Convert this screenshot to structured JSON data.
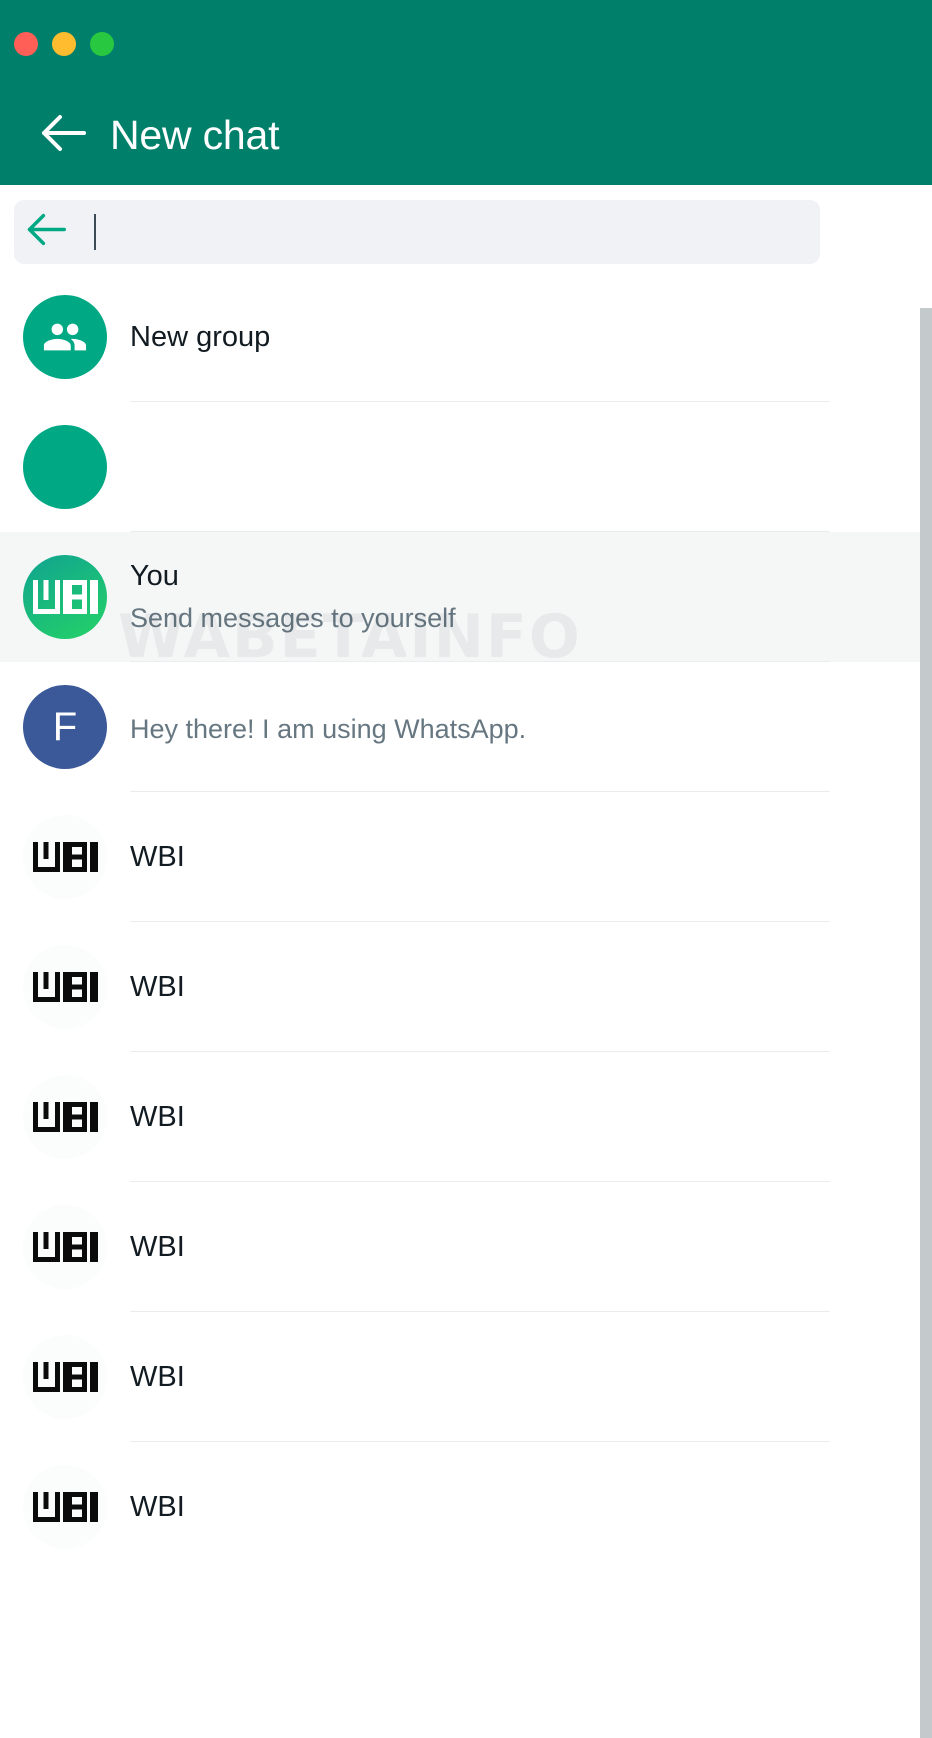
{
  "window": {
    "traffic_lights": [
      {
        "name": "close-button",
        "color": "#ff5f57"
      },
      {
        "name": "minimize-button",
        "color": "#febc2e"
      },
      {
        "name": "maximize-button",
        "color": "#28c840"
      }
    ],
    "header": {
      "back_icon": "arrow-left-icon",
      "title": "New chat",
      "background": "#00806a",
      "title_color": "#ffffff"
    }
  },
  "search": {
    "back_icon": "arrow-left-icon",
    "value": "",
    "placeholder": "",
    "background": "#f0f2f5",
    "caret_visible": true
  },
  "watermark": {
    "text": "WABETAINFO"
  },
  "scrollbar": {
    "orientation": "vertical",
    "thumb_color": "#c4c9cc"
  },
  "list": {
    "rows": [
      {
        "name": "new-group",
        "avatar_type": "green-people",
        "avatar_glyph": "people-icon",
        "title": "New group",
        "subtitle": "",
        "selected": false,
        "divider": true
      },
      {
        "name": "new-contact",
        "avatar_type": "green-plain",
        "avatar_glyph": "",
        "title": "",
        "subtitle": "",
        "selected": false,
        "divider": true
      },
      {
        "name": "message-yourself",
        "avatar_type": "gradient-wbi",
        "avatar_glyph": "WBI",
        "title": "You",
        "subtitle": "Send messages to yourself",
        "selected": true,
        "divider": true
      },
      {
        "name": "contact-f",
        "avatar_type": "blue-letter",
        "avatar_glyph": "F",
        "title": "",
        "subtitle": "Hey there! I am using WhatsApp.",
        "selected": false,
        "divider": true
      },
      {
        "name": "contact-wbi-1",
        "avatar_type": "light-wbi",
        "avatar_glyph": "WBI",
        "title": "WBI",
        "subtitle": "",
        "selected": false,
        "divider": true
      },
      {
        "name": "contact-wbi-2",
        "avatar_type": "light-wbi",
        "avatar_glyph": "WBI",
        "title": "WBI",
        "subtitle": "",
        "selected": false,
        "divider": true
      },
      {
        "name": "contact-wbi-3",
        "avatar_type": "light-wbi",
        "avatar_glyph": "WBI",
        "title": "WBI",
        "subtitle": "",
        "selected": false,
        "divider": true
      },
      {
        "name": "contact-wbi-4",
        "avatar_type": "light-wbi",
        "avatar_glyph": "WBI",
        "title": "WBI",
        "subtitle": "",
        "selected": false,
        "divider": true
      },
      {
        "name": "contact-wbi-5",
        "avatar_type": "light-wbi",
        "avatar_glyph": "WBI",
        "title": "WBI",
        "subtitle": "",
        "selected": false,
        "divider": true
      },
      {
        "name": "contact-wbi-6",
        "avatar_type": "light-wbi",
        "avatar_glyph": "WBI",
        "title": "WBI",
        "subtitle": "",
        "selected": false,
        "divider": false
      }
    ]
  }
}
